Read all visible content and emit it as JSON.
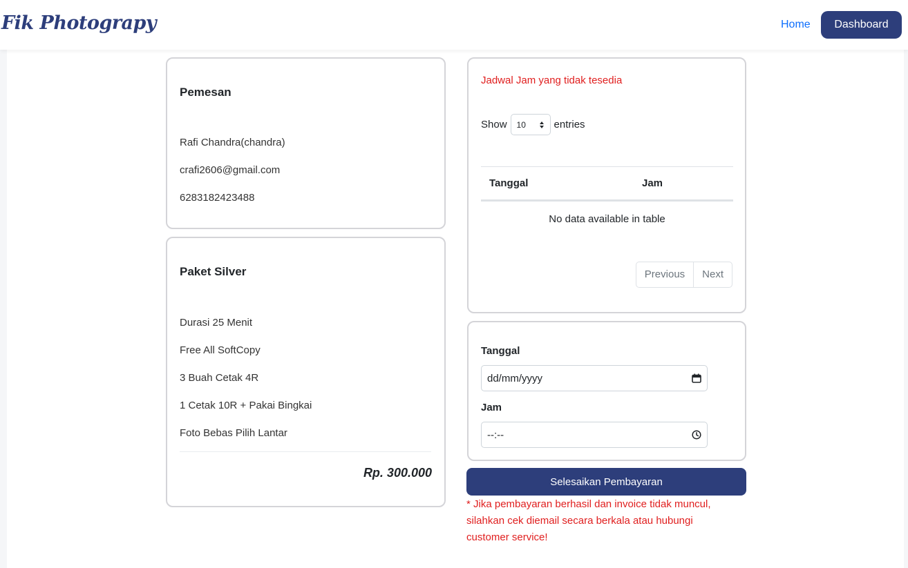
{
  "nav": {
    "brand": "Fik Photograpy",
    "home_label": "Home",
    "dashboard_label": "Dashboard"
  },
  "customer": {
    "title": "Pemesan",
    "name": "Rafi Chandra(chandra)",
    "email": "crafi2606@gmail.com",
    "phone": "6283182423488"
  },
  "package": {
    "title": "Paket Silver",
    "features": [
      "Durasi 25 Menit",
      "Free All SoftCopy",
      "3 Buah Cetak 4R",
      "1 Cetak 10R + Pakai Bingkai",
      "Foto Bebas Pilih Lantar"
    ],
    "price": "Rp. 300.000"
  },
  "schedule": {
    "heading": "Jadwal Jam yang tidak tesedia",
    "show_label": "Show",
    "entries_value": "10",
    "entries_label": "entries",
    "columns": [
      "Tanggal",
      "Jam"
    ],
    "empty_message": "No data available in table",
    "previous_label": "Previous",
    "next_label": "Next"
  },
  "booking": {
    "date_label": "Tanggal",
    "date_placeholder": "dd/mm/yyyy",
    "time_label": "Jam",
    "time_placeholder": "--:--"
  },
  "payment": {
    "button_label": "Selesaikan Pembayaran",
    "note": "* Jika pembayaran berhasil dan invoice tidak muncul, silahkan cek diemail secara berkala atau hubungi customer service!"
  },
  "colors": {
    "primary": "#2d3e7b",
    "link": "#0d6efd",
    "warning_text": "#e01e1e"
  }
}
